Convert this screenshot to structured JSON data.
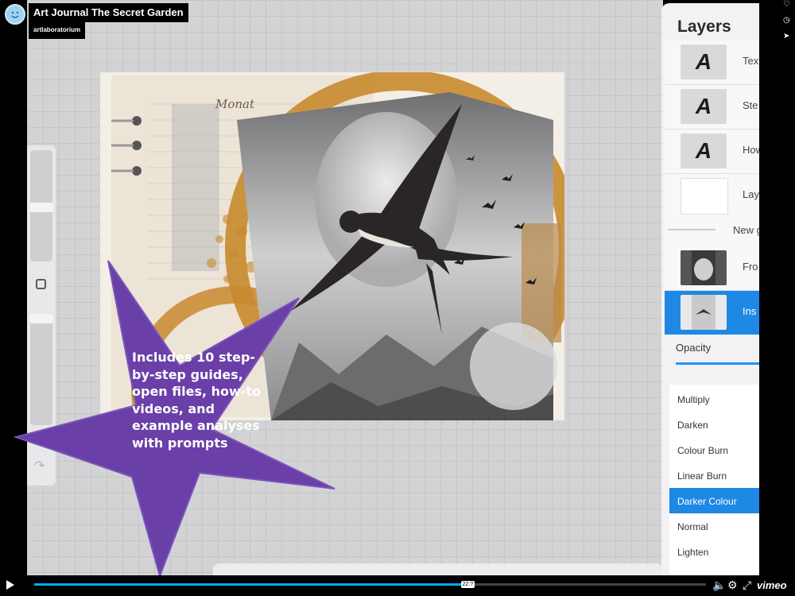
{
  "header": {
    "title": "Art Journal The Secret Garden",
    "author": "artlaboratorium"
  },
  "callout": {
    "text": "Includes 10 step-by-step guides, open files, how-to videos, and example analyses with prompts",
    "color": "#6a3fa8"
  },
  "layers_panel": {
    "title": "Layers",
    "layers": [
      {
        "name": "Tex",
        "thumb": "A",
        "selected": false
      },
      {
        "name": "Ste",
        "thumb": "A",
        "selected": false
      },
      {
        "name": "How",
        "thumb": "A",
        "selected": false
      },
      {
        "name": "Lay",
        "thumb": "blank",
        "selected": false
      },
      {
        "name": "New g",
        "thumb": "group",
        "selected": false
      },
      {
        "name": "Fro",
        "thumb": "image",
        "selected": false
      },
      {
        "name": "Ins",
        "thumb": "image",
        "selected": true
      }
    ],
    "opacity_label": "Opacity",
    "blend_modes": [
      "Multiply",
      "Darken",
      "Colour Burn",
      "Linear Burn",
      "Darker Colour",
      "Normal",
      "Lighten"
    ],
    "selected_blend": "Darker Colour",
    "accent": "#1e88e5"
  },
  "player": {
    "progress": 0.64,
    "time": "22:?",
    "logo": "vimeo",
    "progress_color": "#00adef"
  },
  "rail_icons": [
    "heart-icon",
    "clock-icon",
    "send-icon"
  ]
}
